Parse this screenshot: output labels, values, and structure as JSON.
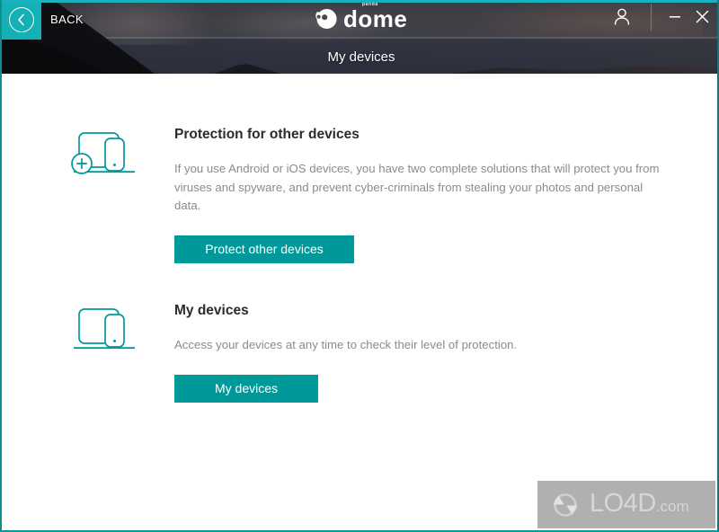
{
  "window": {
    "back_label": "BACK",
    "page_title": "My devices",
    "logo_word": "dome",
    "logo_brandlet": "panda",
    "accent_color": "#00999a",
    "back_button_color": "#15afb6",
    "controls": {
      "account_icon": "user-icon",
      "minimize_icon": "minimize-icon",
      "close_icon": "close-icon"
    }
  },
  "content": {
    "sections": [
      {
        "icon": "devices-add-icon",
        "title": "Protection for other devices",
        "description": "If you use Android or iOS devices, you have two complete solutions that will protect you from viruses and spyware, and prevent cyber-criminals from stealing your photos and personal data.",
        "button_label": "Protect other devices"
      },
      {
        "icon": "devices-icon",
        "title": "My devices",
        "description": "Access your devices at any time to check their level of protection.",
        "button_label": "My devices"
      }
    ]
  },
  "watermark": {
    "name": "LO4D",
    "suffix": ".com",
    "icon": "refresh-circle-icon"
  }
}
